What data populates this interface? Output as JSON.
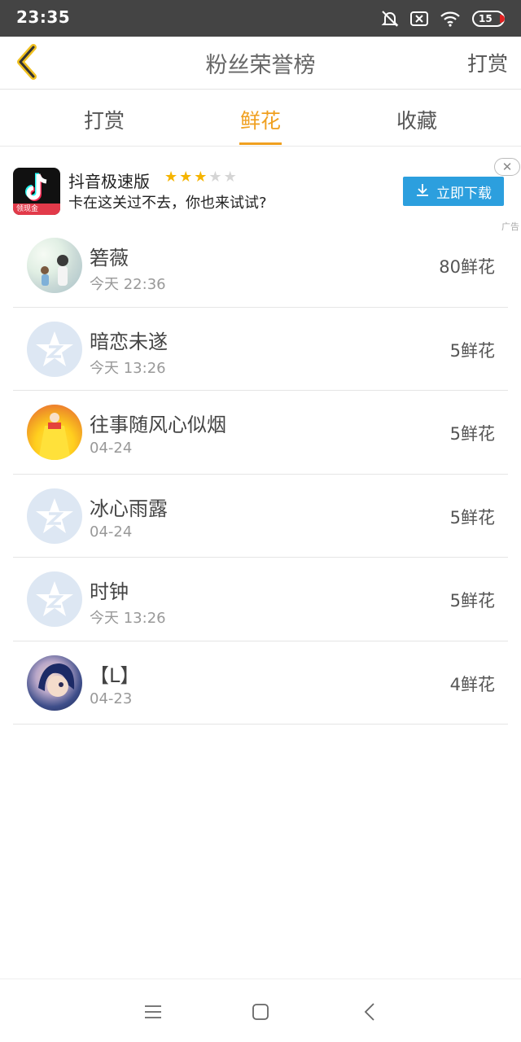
{
  "status_bar": {
    "time": "23:35",
    "battery": "15"
  },
  "header": {
    "title": "粉丝荣誉榜",
    "right_label": "打赏",
    "accent_color": "#f0a020"
  },
  "tabs": [
    {
      "label": "打赏",
      "active": false
    },
    {
      "label": "鲜花",
      "active": true
    },
    {
      "label": "收藏",
      "active": false
    }
  ],
  "ad": {
    "app_name": "抖音极速版",
    "rating": 3,
    "rating_max": 5,
    "description": "卡在这关过不去，你也来试试?",
    "button_label": "立即下载",
    "logo_badge": "领现金",
    "tag": "广告",
    "close_glyph": "✕",
    "button_color": "#2c9fde"
  },
  "fans": [
    {
      "name": "箬薇",
      "time": "今天 22:36",
      "amount": "80鲜花",
      "avatar": "photo-avatar"
    },
    {
      "name": "暗恋未遂",
      "time": "今天 13:26",
      "amount": "5鲜花",
      "avatar": "default-qq-avatar"
    },
    {
      "name": "往事随风心似烟",
      "time": "04-24",
      "amount": "5鲜花",
      "avatar": "photo-avatar"
    },
    {
      "name": "冰心雨露",
      "time": "04-24",
      "amount": "5鲜花",
      "avatar": "default-qq-avatar"
    },
    {
      "name": "时钟",
      "time": "今天 13:26",
      "amount": "5鲜花",
      "avatar": "default-qq-avatar"
    },
    {
      "name": "【L】",
      "time": "04-23",
      "amount": "4鲜花",
      "avatar": "photo-avatar"
    }
  ],
  "bottom_nav": {
    "icons": [
      "menu-icon",
      "home-icon",
      "back-icon"
    ]
  }
}
